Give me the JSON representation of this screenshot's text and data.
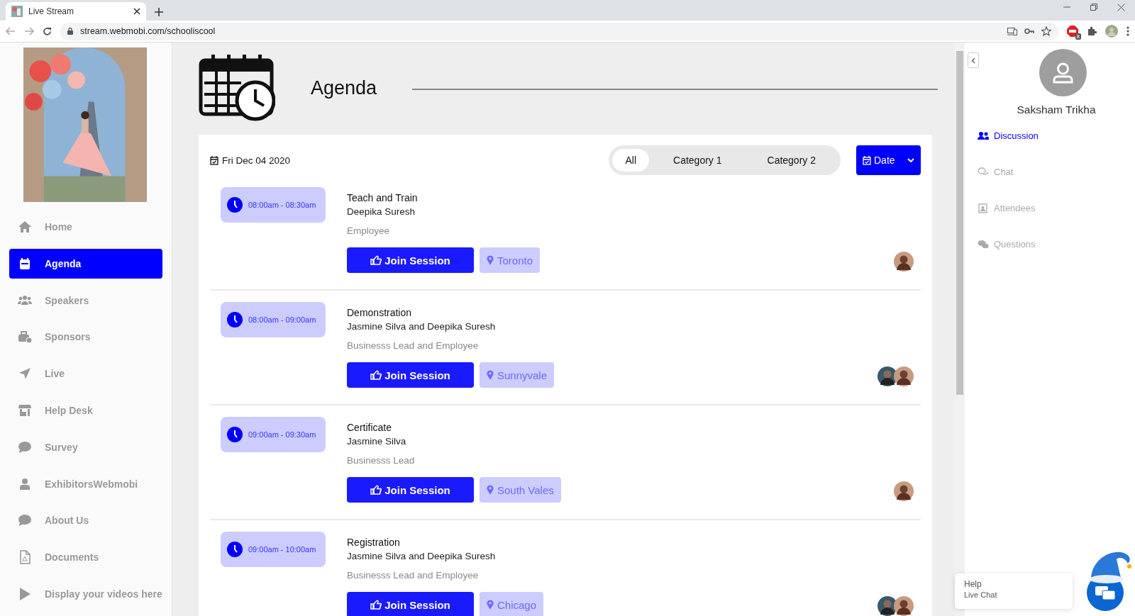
{
  "browser": {
    "tab_title": "Live Stream",
    "url": "stream.webmobi.com/schooliscool",
    "extension_badge": "8"
  },
  "sidebar": {
    "items": [
      {
        "label": "Home",
        "selected": false
      },
      {
        "label": "Agenda",
        "selected": true
      },
      {
        "label": "Speakers",
        "selected": false
      },
      {
        "label": "Sponsors",
        "selected": false
      },
      {
        "label": "Live",
        "selected": false
      },
      {
        "label": "Help Desk",
        "selected": false
      },
      {
        "label": "Survey",
        "selected": false
      },
      {
        "label": "ExhibitorsWebmobi",
        "selected": false
      },
      {
        "label": "About Us",
        "selected": false
      },
      {
        "label": "Documents",
        "selected": false
      },
      {
        "label": "Display your videos here",
        "selected": false
      }
    ]
  },
  "page": {
    "title": "Agenda"
  },
  "agenda": {
    "date": "Fri Dec 04 2020",
    "filters": [
      {
        "label": "All",
        "selected": true
      },
      {
        "label": "Category 1",
        "selected": false
      },
      {
        "label": "Category 2",
        "selected": false
      }
    ],
    "date_button": "Date",
    "sessions": [
      {
        "time": "08:00am - 08:30am",
        "title": "Teach and Train",
        "speakers": "Deepika Suresh",
        "role": "Employee",
        "join_label": "Join Session",
        "location": "Toronto"
      },
      {
        "time": "08:00am - 09:00am",
        "title": "Demonstration",
        "speakers": "Jasmine Silva and Deepika Suresh",
        "role": "Businesss Lead and Employee",
        "join_label": "Join Session",
        "location": "Sunnyvale"
      },
      {
        "time": "09:00am - 09:30am",
        "title": "Certificate",
        "speakers": "Jasmine Silva",
        "role": "Businesss Lead",
        "join_label": "Join Session",
        "location": "South Vales"
      },
      {
        "time": "09:00am - 10:00am",
        "title": "Registration",
        "speakers": "Jasmine Silva and Deepika Suresh",
        "role": "Businesss Lead and Employee",
        "join_label": "Join Session",
        "location": "Chicago"
      }
    ]
  },
  "profile": {
    "name": "Saksham Trikha"
  },
  "right_menu": [
    {
      "label": "Discussion",
      "selected": true
    },
    {
      "label": "Chat",
      "selected": false
    },
    {
      "label": "Attendees",
      "selected": false
    },
    {
      "label": "Questions",
      "selected": false
    }
  ],
  "help_widget": {
    "title": "Help",
    "subtitle": "Live Chat"
  }
}
